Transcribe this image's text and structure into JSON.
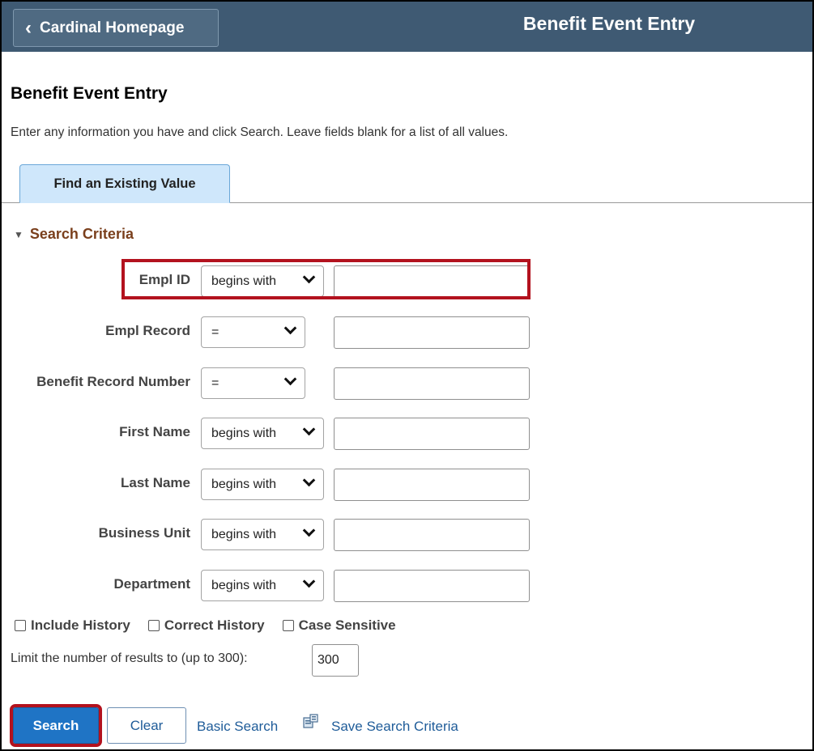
{
  "header": {
    "back_label": "Cardinal Homepage",
    "title": "Benefit Event Entry"
  },
  "page": {
    "title": "Benefit Event Entry",
    "instructions": "Enter any information you have and click Search. Leave fields blank for a list of all values."
  },
  "tabs": [
    {
      "label": "Find an Existing Value"
    }
  ],
  "search_criteria": {
    "heading": "Search Criteria",
    "fields": [
      {
        "label": "Empl ID",
        "operator": "begins with",
        "value": ""
      },
      {
        "label": "Empl Record",
        "operator": "=",
        "value": ""
      },
      {
        "label": "Benefit Record Number",
        "operator": "=",
        "value": ""
      },
      {
        "label": "First Name",
        "operator": "begins with",
        "value": ""
      },
      {
        "label": "Last Name",
        "operator": "begins with",
        "value": ""
      },
      {
        "label": "Business Unit",
        "operator": "begins with",
        "value": ""
      },
      {
        "label": "Department",
        "operator": "begins with",
        "value": ""
      }
    ],
    "checkboxes": [
      {
        "label": "Include History",
        "checked": false
      },
      {
        "label": "Correct History",
        "checked": false
      },
      {
        "label": "Case Sensitive",
        "checked": false
      }
    ],
    "limit_label": "Limit the number of results to (up to 300):",
    "limit_value": "300"
  },
  "actions": {
    "search_label": "Search",
    "clear_label": "Clear",
    "basic_search_label": "Basic Search",
    "save_criteria_label": "Save Search Criteria"
  },
  "colors": {
    "header_bg": "#3f5a73",
    "tab_bg": "#cfe7fb",
    "section_heading": "#7a3f1c",
    "primary_button": "#1f74c5",
    "highlight_outline": "#b3121e",
    "link": "#1f5c99"
  },
  "icons": {
    "back": "chevron-left-icon",
    "section_toggle": "triangle-down-icon",
    "dropdown": "chevron-down-icon",
    "save_criteria": "save-criteria-icon"
  }
}
